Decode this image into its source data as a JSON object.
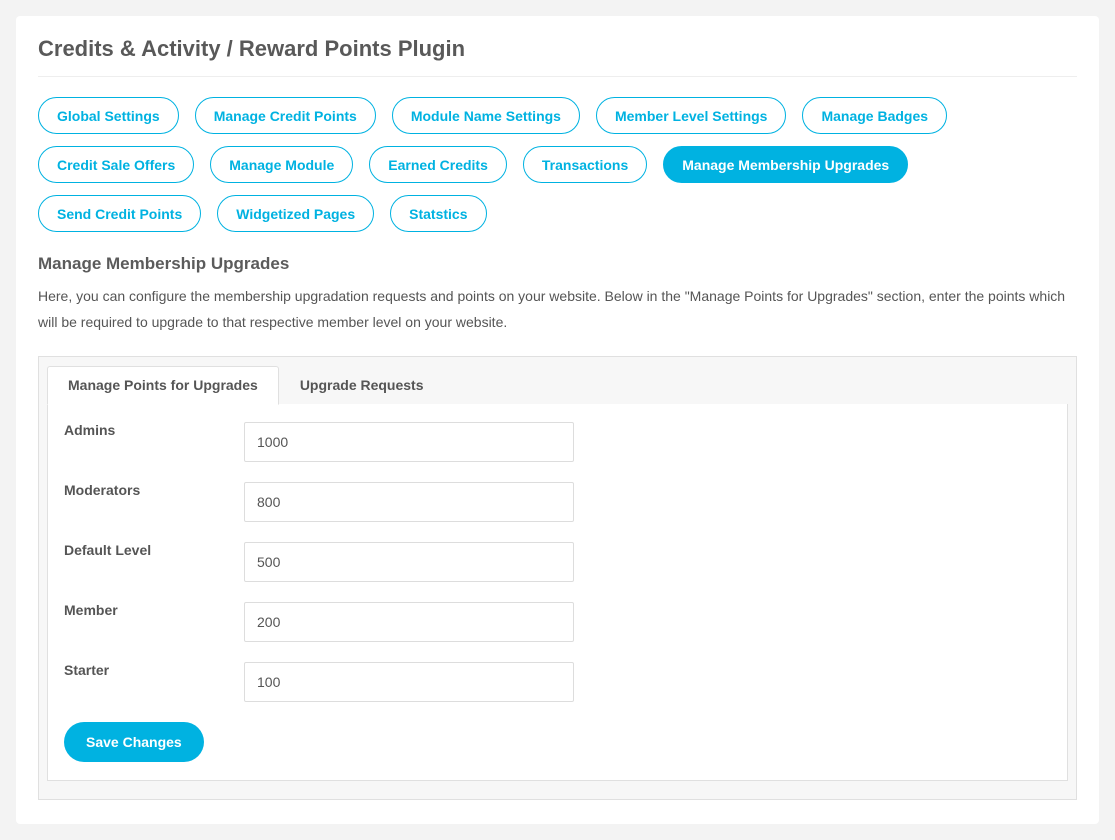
{
  "page_title": "Credits & Activity / Reward Points Plugin",
  "nav_pills": [
    {
      "label": "Global Settings",
      "active": false
    },
    {
      "label": "Manage Credit Points",
      "active": false
    },
    {
      "label": "Module Name Settings",
      "active": false
    },
    {
      "label": "Member Level Settings",
      "active": false
    },
    {
      "label": "Manage Badges",
      "active": false
    },
    {
      "label": "Credit Sale Offers",
      "active": false
    },
    {
      "label": "Manage Module",
      "active": false
    },
    {
      "label": "Earned Credits",
      "active": false
    },
    {
      "label": "Transactions",
      "active": false
    },
    {
      "label": "Manage Membership Upgrades",
      "active": true
    },
    {
      "label": "Send Credit Points",
      "active": false
    },
    {
      "label": "Widgetized Pages",
      "active": false
    },
    {
      "label": "Statstics",
      "active": false
    }
  ],
  "section": {
    "title": "Manage Membership Upgrades",
    "description": "Here, you can configure the membership upgradation requests and points on your website. Below in the \"Manage Points for Upgrades\" section, enter the points which will be required to upgrade to that respective member level on your website."
  },
  "tabs": [
    {
      "label": "Manage Points for Upgrades",
      "active": true
    },
    {
      "label": "Upgrade Requests",
      "active": false
    }
  ],
  "levels": [
    {
      "label": "Admins",
      "value": "1000"
    },
    {
      "label": "Moderators",
      "value": "800"
    },
    {
      "label": "Default Level",
      "value": "500"
    },
    {
      "label": "Member",
      "value": "200"
    },
    {
      "label": "Starter",
      "value": "100"
    }
  ],
  "save_label": "Save Changes",
  "colors": {
    "accent": "#00b2e1",
    "panel_bg": "#ffffff",
    "page_bg": "#f3f3f3"
  }
}
